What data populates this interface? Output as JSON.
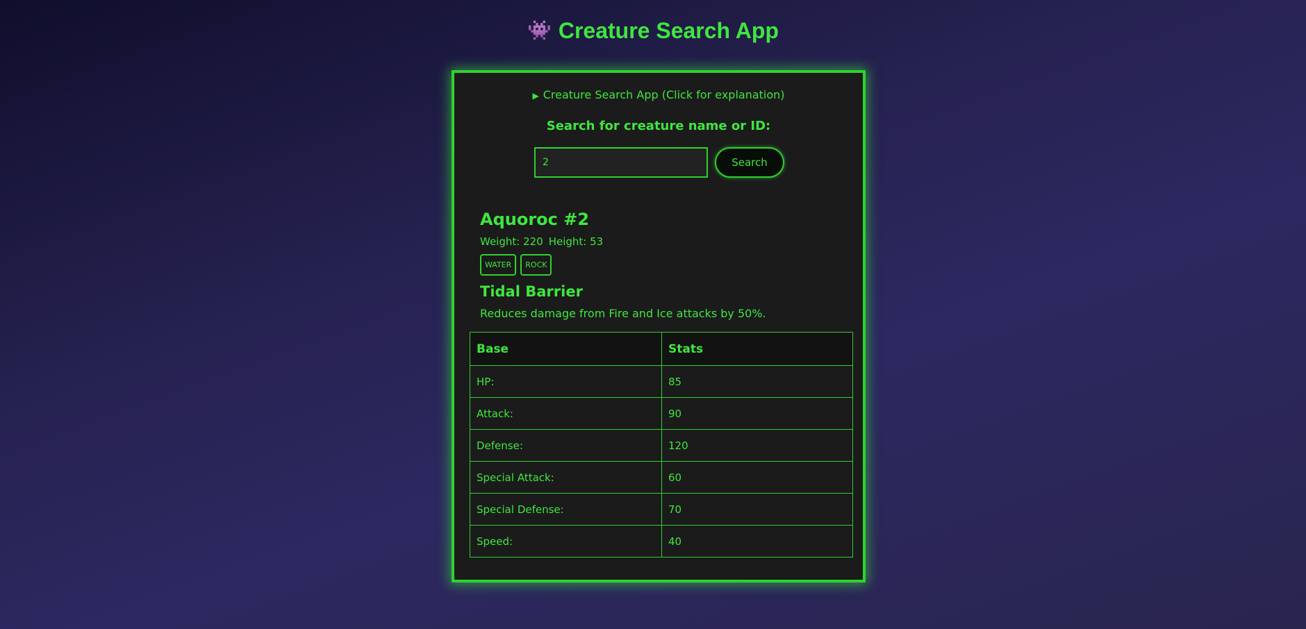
{
  "header": {
    "icon": "alien-monster-icon",
    "icon_glyph": "👾",
    "title": "Creature Search App"
  },
  "explanation": {
    "label": "Creature Search App (Click for explanation)",
    "expanded": false
  },
  "search": {
    "label": "Search for creature name or ID:",
    "value": "2",
    "button_label": "Search"
  },
  "creature": {
    "name": "Aquoroc #2",
    "weight": "Weight: 220",
    "height": "Height: 53",
    "types": [
      "WATER",
      "ROCK"
    ],
    "ability_name": "Tidal Barrier",
    "ability_description": "Reduces damage from Fire and Ice attacks by 50%."
  },
  "stats_table": {
    "headers": [
      "Base",
      "Stats"
    ],
    "rows": [
      {
        "label": "HP:",
        "value": "85"
      },
      {
        "label": "Attack:",
        "value": "90"
      },
      {
        "label": "Defense:",
        "value": "120"
      },
      {
        "label": "Special Attack:",
        "value": "60"
      },
      {
        "label": "Special Defense:",
        "value": "70"
      },
      {
        "label": "Speed:",
        "value": "40"
      }
    ]
  },
  "colors": {
    "accent": "#3fe63f",
    "card_background": "#1b1b1b"
  }
}
